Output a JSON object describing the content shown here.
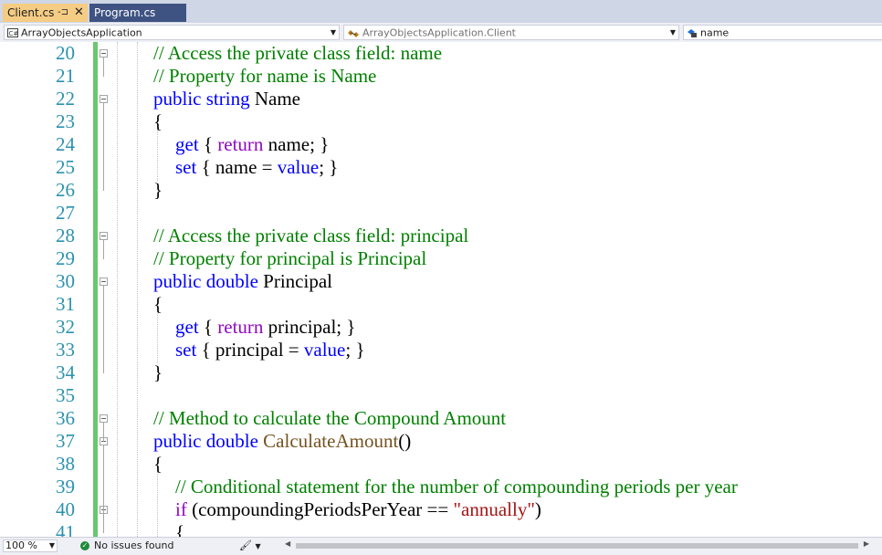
{
  "tabs": [
    {
      "label": "Client.cs",
      "active": true,
      "pinned": true
    },
    {
      "label": "Program.cs",
      "active": false
    }
  ],
  "nav": {
    "project": "ArrayObjectsApplication",
    "class": "ArrayObjectsApplication.Client",
    "member": "name",
    "project_icon": "csharp-project-icon",
    "class_icon": "class-icon",
    "member_icon": "field-icon"
  },
  "editor": {
    "lines": [
      {
        "n": "20",
        "indent": 0,
        "fold": true,
        "tokens": [
          {
            "t": "// Access the private class field: name",
            "c": "cm"
          }
        ]
      },
      {
        "n": "21",
        "indent": 0,
        "fold": false,
        "tokens": [
          {
            "t": "// Property for name is Name",
            "c": "cm"
          }
        ]
      },
      {
        "n": "22",
        "indent": 0,
        "fold": true,
        "tokens": [
          {
            "t": "public",
            "c": "kw"
          },
          {
            "t": " "
          },
          {
            "t": "string",
            "c": "kw"
          },
          {
            "t": " Name"
          }
        ]
      },
      {
        "n": "23",
        "indent": 0,
        "fold": false,
        "tokens": [
          {
            "t": "{"
          }
        ]
      },
      {
        "n": "24",
        "indent": 1,
        "fold": false,
        "tokens": [
          {
            "t": "get",
            "c": "kw"
          },
          {
            "t": " { "
          },
          {
            "t": "return",
            "c": "ctl"
          },
          {
            "t": " name; }"
          }
        ]
      },
      {
        "n": "25",
        "indent": 1,
        "fold": false,
        "tokens": [
          {
            "t": "set",
            "c": "kw"
          },
          {
            "t": " { name = "
          },
          {
            "t": "value",
            "c": "kw"
          },
          {
            "t": "; }"
          }
        ]
      },
      {
        "n": "26",
        "indent": 0,
        "fold": false,
        "tokens": [
          {
            "t": "}"
          }
        ]
      },
      {
        "n": "27",
        "indent": 0,
        "fold": false,
        "tokens": []
      },
      {
        "n": "28",
        "indent": 0,
        "fold": true,
        "tokens": [
          {
            "t": "// Access the private class field: principal",
            "c": "cm"
          }
        ]
      },
      {
        "n": "29",
        "indent": 0,
        "fold": false,
        "tokens": [
          {
            "t": "// Property for principal is Principal",
            "c": "cm"
          }
        ]
      },
      {
        "n": "30",
        "indent": 0,
        "fold": true,
        "tokens": [
          {
            "t": "public",
            "c": "kw"
          },
          {
            "t": " "
          },
          {
            "t": "double",
            "c": "kw"
          },
          {
            "t": " Principal"
          }
        ]
      },
      {
        "n": "31",
        "indent": 0,
        "fold": false,
        "tokens": [
          {
            "t": "{"
          }
        ]
      },
      {
        "n": "32",
        "indent": 1,
        "fold": false,
        "tokens": [
          {
            "t": "get",
            "c": "kw"
          },
          {
            "t": " { "
          },
          {
            "t": "return",
            "c": "ctl"
          },
          {
            "t": " principal; }"
          }
        ]
      },
      {
        "n": "33",
        "indent": 1,
        "fold": false,
        "tokens": [
          {
            "t": "set",
            "c": "kw"
          },
          {
            "t": " { principal = "
          },
          {
            "t": "value",
            "c": "kw"
          },
          {
            "t": "; }"
          }
        ]
      },
      {
        "n": "34",
        "indent": 0,
        "fold": false,
        "tokens": [
          {
            "t": "}"
          }
        ]
      },
      {
        "n": "35",
        "indent": 0,
        "fold": false,
        "tokens": []
      },
      {
        "n": "36",
        "indent": 0,
        "fold": true,
        "tokens": [
          {
            "t": "// Method to calculate the Compound Amount",
            "c": "cm"
          }
        ]
      },
      {
        "n": "37",
        "indent": 0,
        "fold": true,
        "tokens": [
          {
            "t": "public",
            "c": "kw"
          },
          {
            "t": " "
          },
          {
            "t": "double",
            "c": "kw"
          },
          {
            "t": " "
          },
          {
            "t": "CalculateAmount",
            "c": "mth"
          },
          {
            "t": "()"
          }
        ]
      },
      {
        "n": "38",
        "indent": 0,
        "fold": false,
        "tokens": [
          {
            "t": "{"
          }
        ]
      },
      {
        "n": "39",
        "indent": 1,
        "fold": false,
        "tokens": [
          {
            "t": "// Conditional statement for the number of compounding periods per year",
            "c": "cm"
          }
        ]
      },
      {
        "n": "40",
        "indent": 1,
        "fold": true,
        "tokens": [
          {
            "t": "if",
            "c": "ctl"
          },
          {
            "t": " (compoundingPeriodsPerYear == "
          },
          {
            "t": "\"annually\"",
            "c": "str"
          },
          {
            "t": ")"
          }
        ]
      },
      {
        "n": "41",
        "indent": 1,
        "fold": false,
        "tokens": [
          {
            "t": "{"
          }
        ]
      }
    ]
  },
  "status": {
    "zoom": "100 %",
    "issues": "No issues found",
    "issues_icon": "check-circle-icon",
    "cleanup_icon": "brush-icon"
  },
  "colors": {
    "keyword": "#0000ff",
    "control": "#8f08c4",
    "comment": "#008000",
    "string": "#a31515",
    "method": "#74531f",
    "line_number": "#2b91af",
    "change_bar": "#6bc771",
    "active_tab": "#f5cc84"
  }
}
